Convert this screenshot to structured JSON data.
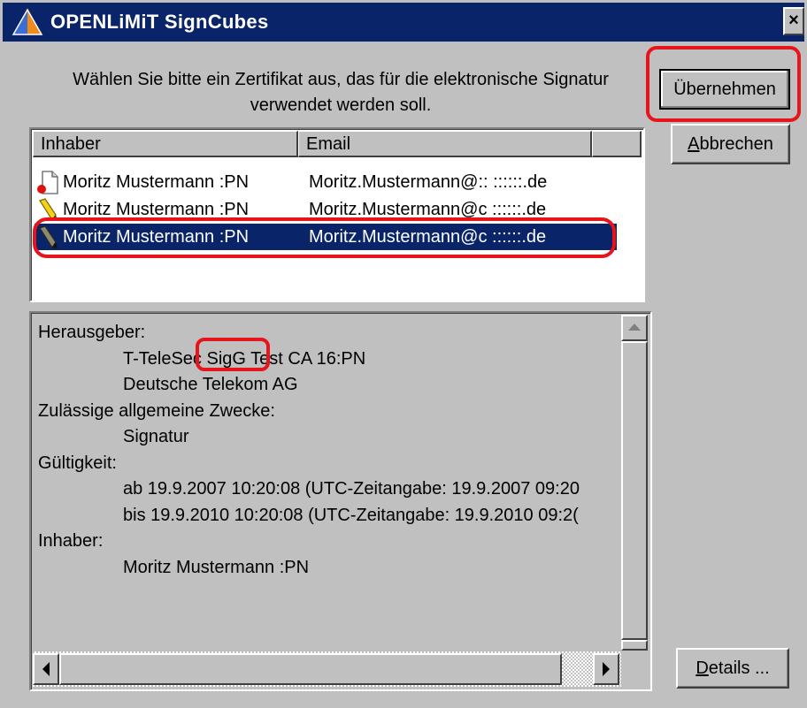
{
  "window": {
    "title": "OPENLiMiT SignCubes",
    "close_label": "×"
  },
  "prompt": "Wählen Sie bitte ein Zertifikat aus, das für die elektronische Signatur verwendet werden soll.",
  "buttons": {
    "ok": "Übernehmen",
    "cancel_pre": "",
    "cancel_accel": "A",
    "cancel_rest": "bbrechen",
    "details_accel": "D",
    "details_rest": "etails ..."
  },
  "list": {
    "columns": [
      "Inhaber",
      "Email"
    ],
    "rows": [
      {
        "owner": "Moritz Mustermann :PN",
        "email": "Moritz.Mustermann@:: ::::::.de",
        "icon": "certificate-red-icon",
        "selected": false
      },
      {
        "owner": "Moritz Mustermann :PN",
        "email": "Moritz.Mustermann@c ::::::.de",
        "icon": "signature-pen-icon",
        "selected": false
      },
      {
        "owner": "Moritz Mustermann :PN",
        "email": "Moritz.Mustermann@c ::::::.de",
        "icon": "signature-pen-icon",
        "selected": true
      }
    ]
  },
  "details": {
    "issuer_label": "Herausgeber:",
    "issuer_line1": "T-TeleSec SigG Test CA 16:PN",
    "issuer_line2": "Deutsche Telekom AG",
    "purpose_label": "Zulässige allgemeine Zwecke:",
    "purpose_value": "Signatur",
    "validity_label": "Gültigkeit:",
    "valid_from": "ab 19.9.2007 10:20:08 (UTC-Zeitangabe: 19.9.2007 09:20",
    "valid_to": "bis 19.9.2010 10:20:08 (UTC-Zeitangabe: 19.9.2010 09:2(",
    "holder_label": "Inhaber:",
    "holder_value": "Moritz Mustermann :PN"
  },
  "colors": {
    "selection": "#0a246a",
    "annotation": "#e8141b",
    "face": "#c0c0c0"
  }
}
